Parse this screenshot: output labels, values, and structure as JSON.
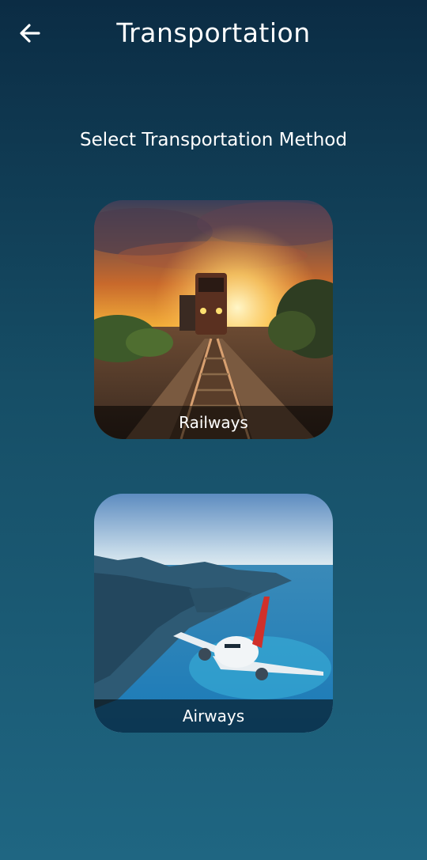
{
  "header": {
    "title": "Transportation",
    "back_icon": "arrow-left-icon"
  },
  "main": {
    "subtitle": "Select Transportation Method",
    "options": [
      {
        "label": "Railways",
        "image": "train-sunset-image"
      },
      {
        "label": "Airways",
        "image": "airplane-coast-image"
      }
    ]
  },
  "colors": {
    "background_top": "#0b2c44",
    "background_bottom": "#1f6682",
    "text": "#ffffff"
  }
}
